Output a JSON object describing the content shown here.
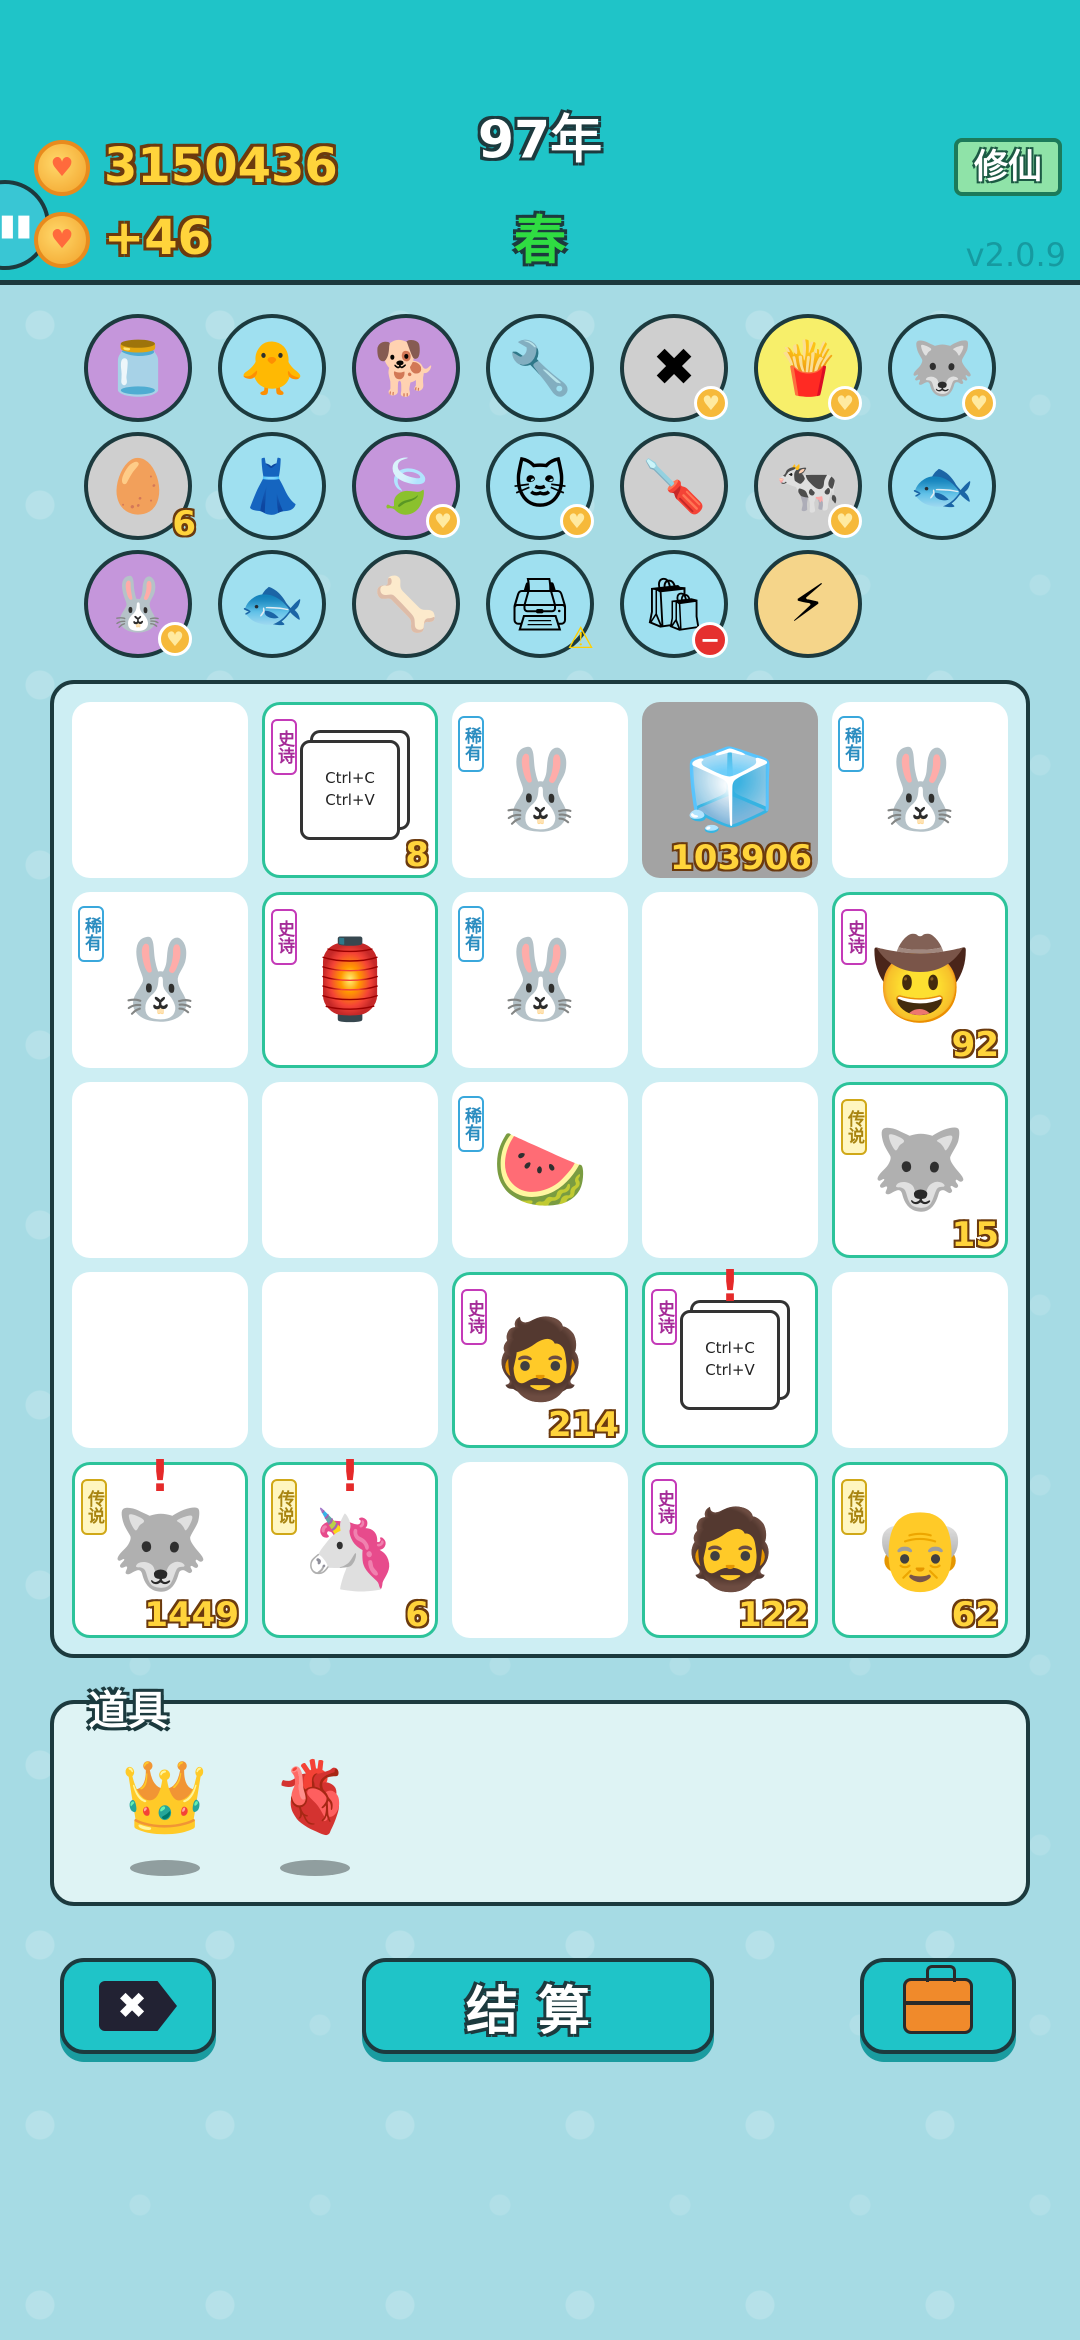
{
  "header": {
    "coins": "3150436",
    "coin_gain": "+46",
    "year": "97年",
    "season": "春",
    "mode_button": "修仙",
    "version": "v2.0.9"
  },
  "symbols": [
    {
      "name": "milk-jar-icon",
      "glyph": "🫙",
      "bg": "#c596db",
      "badge": ""
    },
    {
      "name": "chick-with-egg-icon",
      "glyph": "🐥",
      "bg": "#9fe0f0",
      "badge": ""
    },
    {
      "name": "dog-with-chain-icon",
      "glyph": "🐕",
      "bg": "#c596db",
      "badge": ""
    },
    {
      "name": "air-pump-icon",
      "glyph": "🔧",
      "bg": "#9fe0f0",
      "badge": ""
    },
    {
      "name": "remove-tag-icon",
      "glyph": "✖",
      "bg": "#cfcfcf",
      "badge": "heart"
    },
    {
      "name": "french-fries-icon",
      "glyph": "🍟",
      "bg": "#f7ef6a",
      "badge": "heart"
    },
    {
      "name": "husky-icon",
      "glyph": "🐺",
      "bg": "#9fe0f0",
      "badge": "heart"
    },
    {
      "name": "egg-tray-icon",
      "glyph": "🥚",
      "bg": "#cfcfcf",
      "badge": "count",
      "count": "6"
    },
    {
      "name": "pleated-skirt-icon",
      "glyph": "👗",
      "bg": "#9fe0f0",
      "badge": ""
    },
    {
      "name": "leaf-icon",
      "glyph": "🍃",
      "bg": "#c596db",
      "badge": "heart"
    },
    {
      "name": "cat-icon",
      "glyph": "🐱",
      "bg": "#9fe0f0",
      "badge": "heart"
    },
    {
      "name": "screwdriver-icon",
      "glyph": "🪛",
      "bg": "#cfcfcf",
      "badge": ""
    },
    {
      "name": "cow-pair-icon",
      "glyph": "🐄",
      "bg": "#cfcfcf",
      "badge": "heart"
    },
    {
      "name": "fish-bowl-icon",
      "glyph": "🐟",
      "bg": "#9fe0f0",
      "badge": ""
    },
    {
      "name": "rabbit-icon",
      "glyph": "🐰",
      "bg": "#c596db",
      "badge": "heart"
    },
    {
      "name": "fish-bowl-icon",
      "glyph": "🐟",
      "bg": "#9fe0f0",
      "badge": ""
    },
    {
      "name": "dog-food-bowl-icon",
      "glyph": "🦴",
      "bg": "#cfcfcf",
      "badge": ""
    },
    {
      "name": "printer-icon",
      "glyph": "🖨",
      "bg": "#9fe0f0",
      "badge": "warn"
    },
    {
      "name": "trash-bag-icon",
      "glyph": "🛍",
      "bg": "#9fe0f0",
      "badge": "minus"
    },
    {
      "name": "lightning-icon",
      "glyph": "⚡",
      "bg": "#f5d58a",
      "badge": ""
    }
  ],
  "grid": [
    {
      "tag": "",
      "rarity": "",
      "glyph": "",
      "count": "",
      "name": "empty-cell",
      "alert": false,
      "special": ""
    },
    {
      "tag": "史诗",
      "rarity": "epic",
      "glyph": "",
      "count": "8",
      "name": "copy-paste-card-cell",
      "alert": false,
      "special": "card"
    },
    {
      "tag": "稀有",
      "rarity": "rare",
      "glyph": "🐰",
      "count": "",
      "name": "rabbit-cell",
      "alert": false,
      "special": ""
    },
    {
      "tag": "",
      "rarity": "gray",
      "glyph": "🧊",
      "count": "103906",
      "name": "fridge-cell",
      "alert": false,
      "special": ""
    },
    {
      "tag": "稀有",
      "rarity": "rare",
      "glyph": "🐰",
      "count": "",
      "name": "rabbit-cell",
      "alert": false,
      "special": ""
    },
    {
      "tag": "稀有",
      "rarity": "rare",
      "glyph": "🐰",
      "count": "",
      "name": "rabbit-cell",
      "alert": false,
      "special": ""
    },
    {
      "tag": "史诗",
      "rarity": "epic",
      "glyph": "🏮",
      "count": "",
      "name": "rabbit-house-cell",
      "alert": false,
      "special": ""
    },
    {
      "tag": "稀有",
      "rarity": "rare",
      "glyph": "🐰",
      "count": "",
      "name": "rabbit-cell",
      "alert": false,
      "special": ""
    },
    {
      "tag": "",
      "rarity": "",
      "glyph": "",
      "count": "",
      "name": "empty-cell",
      "alert": false,
      "special": ""
    },
    {
      "tag": "史诗",
      "rarity": "epic",
      "glyph": "🤠",
      "count": "92",
      "name": "farmer-cell",
      "alert": false,
      "special": ""
    },
    {
      "tag": "",
      "rarity": "",
      "glyph": "",
      "count": "",
      "name": "empty-cell",
      "alert": false,
      "special": ""
    },
    {
      "tag": "",
      "rarity": "",
      "glyph": "",
      "count": "",
      "name": "empty-cell",
      "alert": false,
      "special": ""
    },
    {
      "tag": "稀有",
      "rarity": "rare",
      "glyph": "🍉",
      "count": "",
      "name": "watermelon-cell",
      "alert": false,
      "special": ""
    },
    {
      "tag": "",
      "rarity": "",
      "glyph": "",
      "count": "",
      "name": "empty-cell",
      "alert": false,
      "special": ""
    },
    {
      "tag": "传说",
      "rarity": "legend",
      "glyph": "🐺",
      "count": "15",
      "name": "husky-king-cell",
      "alert": false,
      "special": ""
    },
    {
      "tag": "",
      "rarity": "",
      "glyph": "",
      "count": "",
      "name": "empty-cell",
      "alert": false,
      "special": ""
    },
    {
      "tag": "",
      "rarity": "",
      "glyph": "",
      "count": "",
      "name": "empty-cell",
      "alert": false,
      "special": ""
    },
    {
      "tag": "史诗",
      "rarity": "epic",
      "glyph": "🧔",
      "count": "214",
      "name": "bearded-man-cell",
      "alert": false,
      "special": ""
    },
    {
      "tag": "史诗",
      "rarity": "epic",
      "glyph": "",
      "count": "",
      "name": "copy-paste-card-cell",
      "alert": true,
      "special": "card"
    },
    {
      "tag": "",
      "rarity": "",
      "glyph": "",
      "count": "",
      "name": "empty-cell",
      "alert": false,
      "special": ""
    },
    {
      "tag": "传说",
      "rarity": "legend",
      "glyph": "🐺",
      "count": "1449",
      "name": "husky-king-cell",
      "alert": true,
      "special": ""
    },
    {
      "tag": "传说",
      "rarity": "legend",
      "glyph": "🦄",
      "count": "6",
      "name": "unicorn-cell",
      "alert": true,
      "special": ""
    },
    {
      "tag": "",
      "rarity": "",
      "glyph": "",
      "count": "",
      "name": "empty-cell",
      "alert": false,
      "special": ""
    },
    {
      "tag": "史诗",
      "rarity": "epic",
      "glyph": "🧔",
      "count": "122",
      "name": "bearded-man-cell",
      "alert": false,
      "special": ""
    },
    {
      "tag": "传说",
      "rarity": "legend",
      "glyph": "👴",
      "count": "62",
      "name": "bald-elder-cell",
      "alert": false,
      "special": ""
    }
  ],
  "card_text": {
    "line1": "Ctrl+C",
    "line2": "Ctrl+V"
  },
  "tools": {
    "label": "道具",
    "items": [
      {
        "name": "crown-tool-icon",
        "glyph": "👑"
      },
      {
        "name": "liver-tool-icon",
        "glyph": "🫀"
      }
    ]
  },
  "buttons": {
    "settle_label": "结算"
  }
}
